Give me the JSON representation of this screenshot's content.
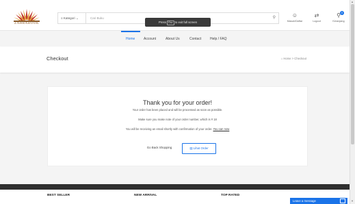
{
  "header": {
    "logo_text": "ZAHRABOOK",
    "category_label": "Kategori",
    "search_placeholder": "Cari Buku",
    "icons": [
      {
        "name": "user-icon",
        "glyph": "♀",
        "label": "Masuk/Daftar"
      },
      {
        "name": "logout-icon",
        "glyph": "⇄",
        "label": "Logout"
      },
      {
        "name": "cart-icon",
        "glyph": "🛒",
        "label": "Keranjang",
        "badge": "0"
      }
    ]
  },
  "toast": {
    "pre": "Press",
    "key": "Esc",
    "post": "to exit full screen"
  },
  "nav": {
    "items": [
      "Home",
      "Account",
      "About Us",
      "Contact",
      "Help / FAQ"
    ],
    "active": "Home"
  },
  "titlebar": {
    "title": "Checkout",
    "crumb_home": "Home",
    "crumb_sep": ">",
    "crumb_current": "Checkout"
  },
  "confirmation": {
    "title": "Thank you for your order!",
    "line1": "Your order has been placed and will be processed as soon as possible.",
    "line2": "Make sure you make note of your order number, which is # 18",
    "line3_pre": "You will be receiving an email shortly with confirmation of your order.",
    "line3_link": "You can now",
    "btn_shop": "Go Back Shopping",
    "btn_order": "Lihat Order"
  },
  "footer": {
    "cols": [
      "BEST SELLER",
      "NEW ARRIVAL",
      "TOP RATED"
    ]
  },
  "chat": {
    "label": "Leave a message"
  },
  "colors": {
    "accent": "#1a73e8",
    "dark": "#2f2f2f"
  }
}
